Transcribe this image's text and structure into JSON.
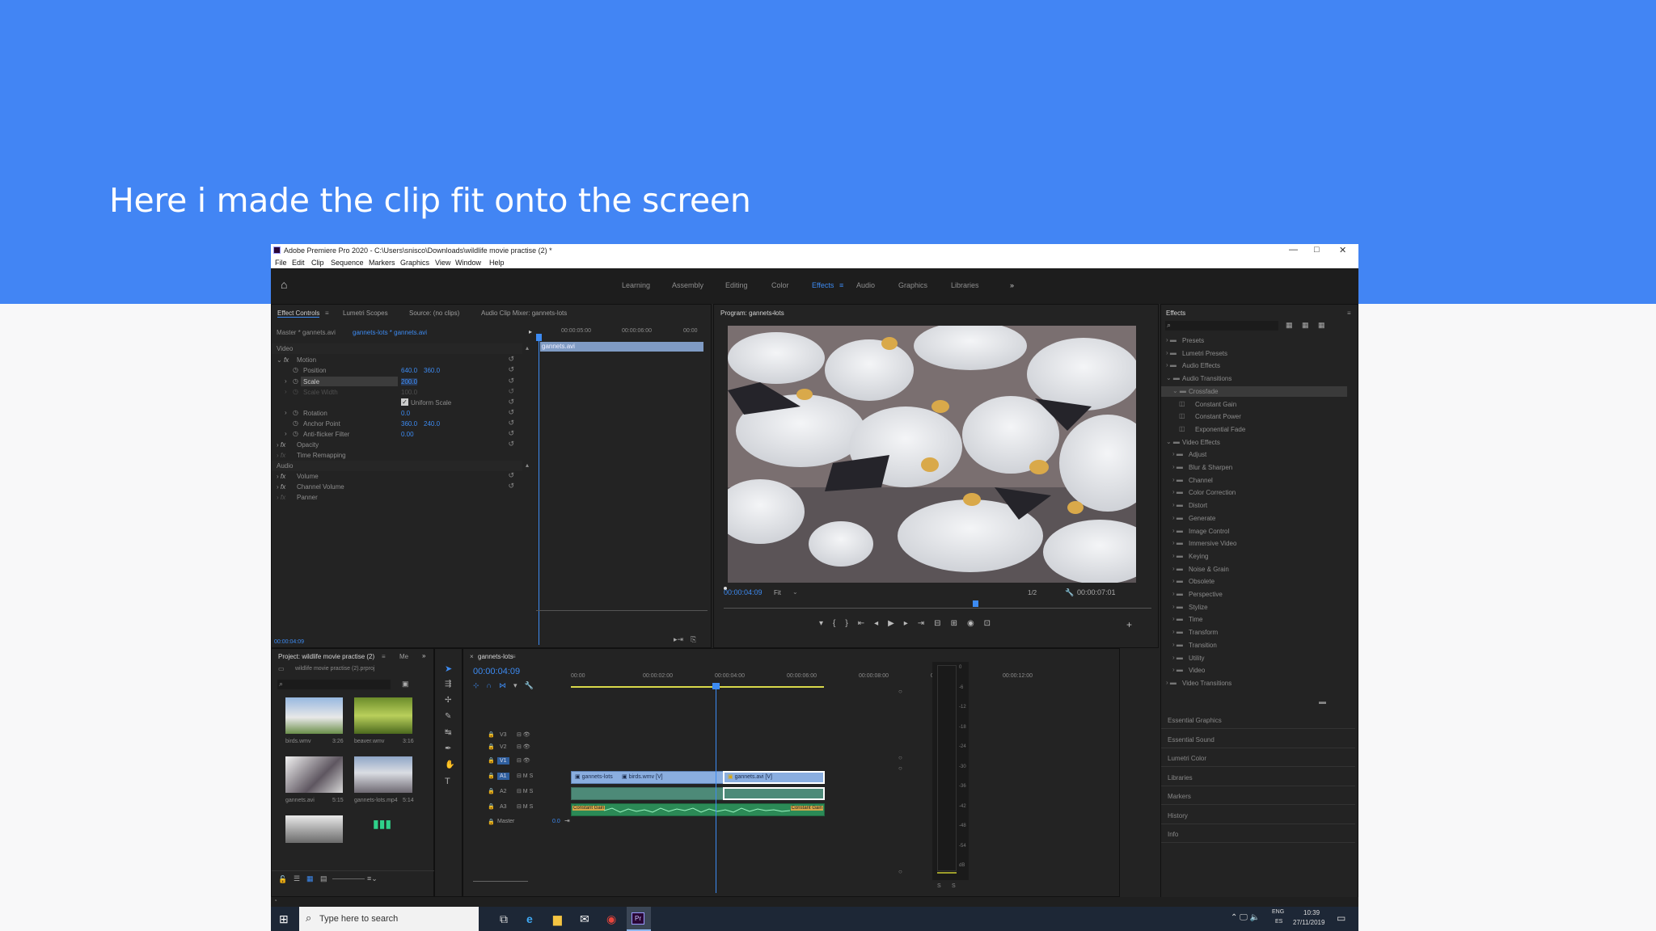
{
  "slide": {
    "title": "Here i made the clip fit onto the screen"
  },
  "window": {
    "title": "Adobe Premiere Pro 2020 - C:\\Users\\snisco\\Downloads\\wildlife movie practise (2) *",
    "minimize": "—",
    "maximize": "□",
    "close": "✕"
  },
  "menu": [
    "File",
    "Edit",
    "Clip",
    "Sequence",
    "Markers",
    "Graphics",
    "View",
    "Window",
    "Help"
  ],
  "workspaces": [
    "Learning",
    "Assembly",
    "Editing",
    "Color",
    "Effects",
    "Audio",
    "Graphics",
    "Libraries"
  ],
  "workspace_more": "»",
  "effect_controls": {
    "tabs": [
      "Effect Controls",
      "Lumetri Scopes",
      "Source: (no clips)",
      "Audio Clip Mixer: gannets-lots"
    ],
    "master": "Master * gannets.avi",
    "sequence": "gannets-lots * gannets.avi",
    "timecodes": [
      "00:00:05:00",
      "00:00:06:00",
      "00:00"
    ],
    "clip_label": "gannets.avi",
    "video_header": "Video",
    "motion": "Motion",
    "position": {
      "label": "Position",
      "x": "640.0",
      "y": "360.0"
    },
    "scale": {
      "label": "Scale",
      "value": "200.0"
    },
    "scale_width": {
      "label": "Scale Width",
      "value": "100.0"
    },
    "uniform_scale": "Uniform Scale",
    "rotation": {
      "label": "Rotation",
      "value": "0.0"
    },
    "anchor": {
      "label": "Anchor Point",
      "x": "360.0",
      "y": "240.0"
    },
    "antiflicker": {
      "label": "Anti-flicker Filter",
      "value": "0.00"
    },
    "opacity": "Opacity",
    "time_remap": "Time Remapping",
    "audio_header": "Audio",
    "volume": "Volume",
    "channel_volume": "Channel Volume",
    "panner": "Panner",
    "timecode": "00:00:04:09"
  },
  "program": {
    "title": "Program: gannets-lots",
    "timecode": "00:00:04:09",
    "fit": "Fit",
    "quality": "1/2",
    "duration": "00:00:07:01"
  },
  "effects_panel": {
    "title": "Effects",
    "tree": [
      {
        "label": "Presets",
        "indent": 0
      },
      {
        "label": "Lumetri Presets",
        "indent": 0
      },
      {
        "label": "Audio Effects",
        "indent": 0
      },
      {
        "label": "Audio Transitions",
        "indent": 0
      },
      {
        "label": "Crossfade",
        "indent": 1,
        "selected": true
      },
      {
        "label": "Constant Gain",
        "indent": 2,
        "leaf": true
      },
      {
        "label": "Constant Power",
        "indent": 2,
        "leaf": true
      },
      {
        "label": "Exponential Fade",
        "indent": 2,
        "leaf": true
      },
      {
        "label": "Video Effects",
        "indent": 0
      },
      {
        "label": "Adjust",
        "indent": 1
      },
      {
        "label": "Blur & Sharpen",
        "indent": 1
      },
      {
        "label": "Channel",
        "indent": 1
      },
      {
        "label": "Color Correction",
        "indent": 1
      },
      {
        "label": "Distort",
        "indent": 1
      },
      {
        "label": "Generate",
        "indent": 1
      },
      {
        "label": "Image Control",
        "indent": 1
      },
      {
        "label": "Immersive Video",
        "indent": 1
      },
      {
        "label": "Keying",
        "indent": 1
      },
      {
        "label": "Noise & Grain",
        "indent": 1
      },
      {
        "label": "Obsolete",
        "indent": 1
      },
      {
        "label": "Perspective",
        "indent": 1
      },
      {
        "label": "Stylize",
        "indent": 1
      },
      {
        "label": "Time",
        "indent": 1
      },
      {
        "label": "Transform",
        "indent": 1
      },
      {
        "label": "Transition",
        "indent": 1
      },
      {
        "label": "Utility",
        "indent": 1
      },
      {
        "label": "Video",
        "indent": 1
      },
      {
        "label": "Video Transitions",
        "indent": 0
      }
    ],
    "side_panels": [
      "Essential Graphics",
      "Essential Sound",
      "Lumetri Color",
      "Libraries",
      "Markers",
      "History",
      "Info"
    ]
  },
  "project": {
    "title": "Project: wildlife movie practise (2)",
    "tab2": "Me",
    "file": "wildlife movie practise (2).prproj",
    "items": [
      {
        "name": "birds.wmv",
        "dur": "3:26"
      },
      {
        "name": "beaver.wmv",
        "dur": "3:16"
      },
      {
        "name": "gannets.avi",
        "dur": "5:15"
      },
      {
        "name": "gannets-lots.mp4",
        "dur": "5:14"
      }
    ]
  },
  "timeline": {
    "title": "gannets-lots",
    "timecode": "00:00:04:09",
    "ruler": [
      "00:00",
      "00:00:02:00",
      "00:00:04:00",
      "00:00:06:00",
      "00:00:08:00",
      "00:00:10:00",
      "00:00:12:00"
    ],
    "tracks": [
      "V3",
      "V2",
      "V1",
      "A1",
      "A2",
      "A3"
    ],
    "master": "Master",
    "master_val": "0.0",
    "clips": {
      "c1": "gannets-lots",
      "c2": "birds.wmv [V]",
      "c3": "gannets.avi [V]",
      "a1": "Constant Gain",
      "a2": "Constant Gain"
    },
    "meter": [
      "0",
      "-6",
      "-12",
      "-18",
      "-24",
      "-30",
      "-36",
      "-42",
      "-48",
      "-54",
      "dB"
    ],
    "solo": [
      "S",
      "S"
    ]
  },
  "taskbar": {
    "search": "Type here to search",
    "lang": "ENG",
    "lang2": "ES",
    "time": "10:39",
    "date": "27/11/2019"
  }
}
